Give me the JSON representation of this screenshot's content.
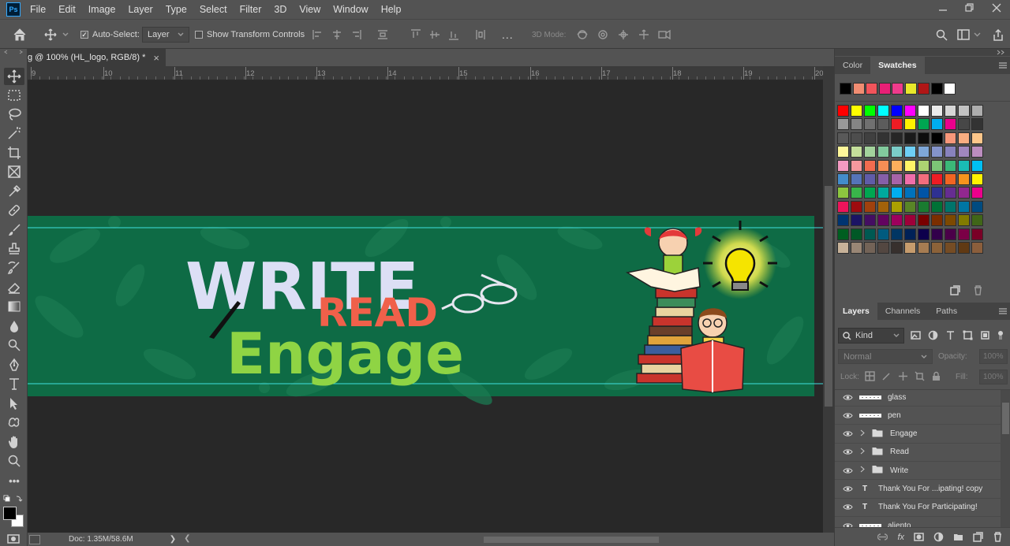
{
  "app": {
    "logo": "Ps"
  },
  "menu": [
    "File",
    "Edit",
    "Image",
    "Layer",
    "Type",
    "Select",
    "Filter",
    "3D",
    "View",
    "Window",
    "Help"
  ],
  "options": {
    "auto_select_label": "Auto-Select:",
    "auto_select_checked": true,
    "auto_select_target": "Layer",
    "show_transform_label": "Show Transform Controls",
    "show_transform_checked": false,
    "three_d_mode_label": "3D Mode:",
    "more_icon": "..."
  },
  "document": {
    "tab_title": "g @ 100% (HL_logo, RGB/8) *",
    "close_glyph": "×",
    "status": "Doc: 1.35M/58.6M",
    "status_arrow": "❯",
    "status_left_arrow": "❮"
  },
  "ruler": {
    "labels": [
      "9",
      "10",
      "11",
      "12",
      "13",
      "14",
      "15",
      "16",
      "17",
      "18",
      "19",
      "20"
    ]
  },
  "artwork": {
    "word1": "WRITE",
    "word2": "READ",
    "word3": "Engage",
    "bg_color": "#0e6b45",
    "write_color": "#dcdff5",
    "read_color": "#f0604a",
    "engage_color": "#8fd444"
  },
  "panels": {
    "top_tabs": [
      "Color",
      "Swatches"
    ],
    "top_active": "Swatches",
    "recent_swatches": [
      "#000000",
      "#f18d72",
      "#f2545b",
      "#e81f76",
      "#ef3b8c",
      "#e8e82a",
      "#b01616",
      "#000000",
      "#ffffff"
    ],
    "swatch_rows": [
      [
        "#ff0000",
        "#ffff00",
        "#00ff00",
        "#00ffff",
        "#0000ff",
        "#ff00ff",
        "#ffffff",
        "#ebebeb",
        "#d6d6d6",
        "#c2c2c2",
        "#adadad"
      ],
      [
        "#999999",
        "#858585",
        "#707070",
        "#5c5c5c",
        "#ed1c24",
        "#fff200",
        "#00a651",
        "#00aeef",
        "#ec008c",
        "#474747",
        "#333333"
      ],
      [
        "#595959",
        "#4d4d4d",
        "#404040",
        "#333333",
        "#262626",
        "#1a1a1a",
        "#0d0d0d",
        "#000000",
        "#f7977a",
        "#f9ad81",
        "#fdc68a"
      ],
      [
        "#fff79a",
        "#c4df9b",
        "#a3d39c",
        "#82ca9d",
        "#7bcdc8",
        "#6ecff6",
        "#7ea7d8",
        "#8493ca",
        "#8882be",
        "#a187be",
        "#bc8dbf"
      ],
      [
        "#f49ac2",
        "#f6989d",
        "#f26c4f",
        "#f68e55",
        "#fbaf5c",
        "#fff467",
        "#acd372",
        "#7cc576",
        "#3bb878",
        "#1abbb4",
        "#00bff3"
      ],
      [
        "#438ccb",
        "#5574b9",
        "#605ca8",
        "#855fa8",
        "#a763a8",
        "#f06eaa",
        "#f26d7d",
        "#ed1c24",
        "#f26522",
        "#f7941d",
        "#fff200"
      ],
      [
        "#8dc63f",
        "#39b54a",
        "#00a651",
        "#00a99d",
        "#00aeef",
        "#0072bc",
        "#0054a6",
        "#2e3192",
        "#662d91",
        "#92278f",
        "#ec008c"
      ],
      [
        "#ed145b",
        "#9e0b0f",
        "#a0410d",
        "#a3620a",
        "#aba000",
        "#598527",
        "#1a7b30",
        "#007236",
        "#00746b",
        "#0076a3",
        "#004b80"
      ],
      [
        "#003471",
        "#1b1464",
        "#440e62",
        "#630460",
        "#9e005d",
        "#9e0039",
        "#790000",
        "#7b2e00",
        "#7d4900",
        "#827b00",
        "#406618"
      ],
      [
        "#005e20",
        "#005826",
        "#005952",
        "#005b7f",
        "#003663",
        "#002157",
        "#0d004c",
        "#32004b",
        "#4b0049",
        "#7b0046",
        "#7a0026"
      ],
      [
        "#c7b299",
        "#998675",
        "#736357",
        "#534741",
        "#37302d",
        "#c69c6d",
        "#a67c52",
        "#8c6239",
        "#754c24",
        "#603913",
        "#8b5e3c"
      ]
    ],
    "layer_tabs": [
      "Layers",
      "Channels",
      "Paths"
    ],
    "layer_active": "Layers",
    "kind_label": "Kind",
    "blend_mode": "Normal",
    "opacity_label": "Opacity:",
    "opacity_value": "100%",
    "lock_label": "Lock:",
    "fill_label": "Fill:",
    "fill_value": "100%",
    "layers": [
      {
        "name": "glass",
        "kind": "raster"
      },
      {
        "name": "pen",
        "kind": "raster"
      },
      {
        "name": "Engage",
        "kind": "group"
      },
      {
        "name": "Read",
        "kind": "group"
      },
      {
        "name": "Write",
        "kind": "group"
      },
      {
        "name": "Thank You For ...ipating! copy",
        "kind": "text"
      },
      {
        "name": "Thank You For Participating!",
        "kind": "text"
      },
      {
        "name": "aliento",
        "kind": "raster"
      }
    ]
  }
}
